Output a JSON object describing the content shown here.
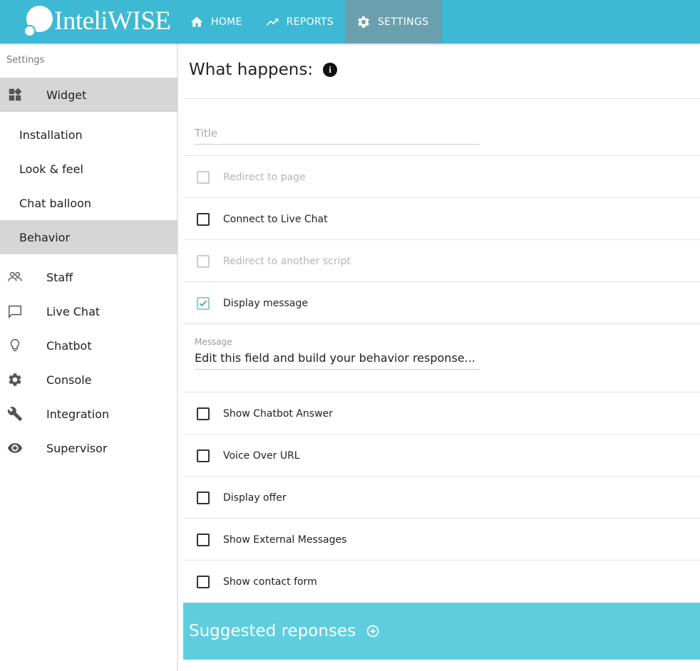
{
  "app": {
    "logo_text": "InteliWISE"
  },
  "nav": [
    {
      "label": "HOME",
      "icon": "home-icon"
    },
    {
      "label": "REPORTS",
      "icon": "trending-up-icon"
    },
    {
      "label": "SETTINGS",
      "icon": "gear-icon",
      "active": true
    }
  ],
  "sidebar": {
    "title": "Settings",
    "items": [
      {
        "label": "Widget",
        "icon": "widgets-icon",
        "active": true
      },
      {
        "label": "Installation"
      },
      {
        "label": "Look & feel"
      },
      {
        "label": "Chat balloon"
      },
      {
        "label": "Behavior",
        "active": true
      },
      {
        "label": "Staff",
        "icon": "people-icon"
      },
      {
        "label": "Live Chat",
        "icon": "chat-bubble-icon"
      },
      {
        "label": "Chatbot",
        "icon": "lightbulb-icon"
      },
      {
        "label": "Console",
        "icon": "gear-icon"
      },
      {
        "label": "Integration",
        "icon": "wrench-icon"
      },
      {
        "label": "Supervisor",
        "icon": "eye-icon"
      }
    ]
  },
  "main": {
    "title": "What happens:",
    "title_placeholder": "Title",
    "options": [
      {
        "label": "Redirect to page",
        "checked": false,
        "disabled": true
      },
      {
        "label": "Connect to Live Chat",
        "checked": false,
        "disabled": false
      },
      {
        "label": "Redirect to another script",
        "checked": false,
        "disabled": true
      },
      {
        "label": "Display message",
        "checked": true,
        "disabled": false
      }
    ],
    "message_label": "Message",
    "message_value": "Edit this field and build your behavior response...",
    "more_options": [
      {
        "label": "Show Chatbot Answer",
        "checked": false
      },
      {
        "label": "Voice Over URL",
        "checked": false
      },
      {
        "label": "Display offer",
        "checked": false
      },
      {
        "label": "Show External Messages",
        "checked": false
      },
      {
        "label": "Show contact form",
        "checked": false
      }
    ],
    "suggested_title": "Suggested reponses"
  },
  "colors": {
    "topbar": "#3db9d3",
    "nav_active": "#6aa0ad",
    "suggest_bar": "#5ecedf",
    "sidebar_active": "#d6d6d6"
  }
}
